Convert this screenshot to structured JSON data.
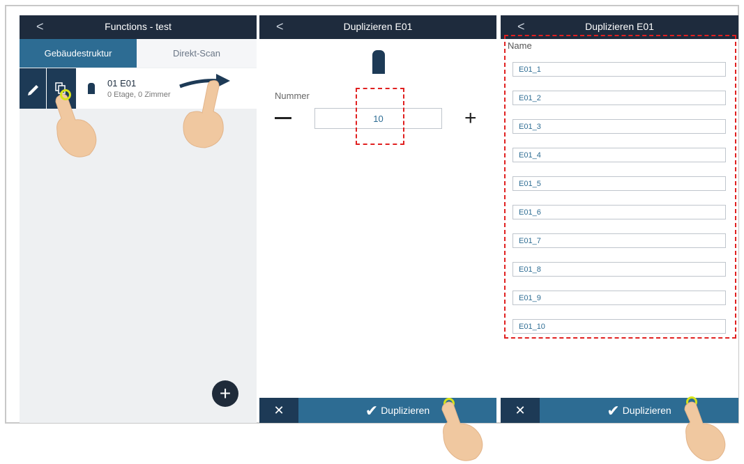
{
  "panel1": {
    "back_glyph": "<",
    "title": "Functions - test",
    "tabs": [
      "Gebäudestruktur",
      "Direkt-Scan"
    ],
    "item": {
      "name": "01 E01",
      "subtitle": "0 Etage, 0 Zimmer"
    },
    "fab_label": "+"
  },
  "panel2": {
    "back_glyph": "<",
    "title": "Duplizieren E01",
    "number_label": "Nummer",
    "number_value": "10",
    "minus_label": "−",
    "plus_label": "+",
    "cancel_label": "✕",
    "confirm_label": "Duplizieren"
  },
  "panel3": {
    "back_glyph": "<",
    "title": "Duplizieren E01",
    "name_label": "Name",
    "names": [
      "E01_1",
      "E01_2",
      "E01_3",
      "E01_4",
      "E01_5",
      "E01_6",
      "E01_7",
      "E01_8",
      "E01_9",
      "E01_10"
    ],
    "cancel_label": "✕",
    "confirm_label": "Duplizieren"
  },
  "icons": {
    "edit": "pencil-icon",
    "duplicate": "duplicate-icon",
    "document": "document-icon",
    "swipe_arrow": "swipe-arrow-icon",
    "hand": "hand-pointer-icon"
  },
  "colors": {
    "topbar": "#1e2b3d",
    "accent": "#2d6c93",
    "highlight_dash": "#e02020",
    "tap_ring": "#d6e21a"
  }
}
